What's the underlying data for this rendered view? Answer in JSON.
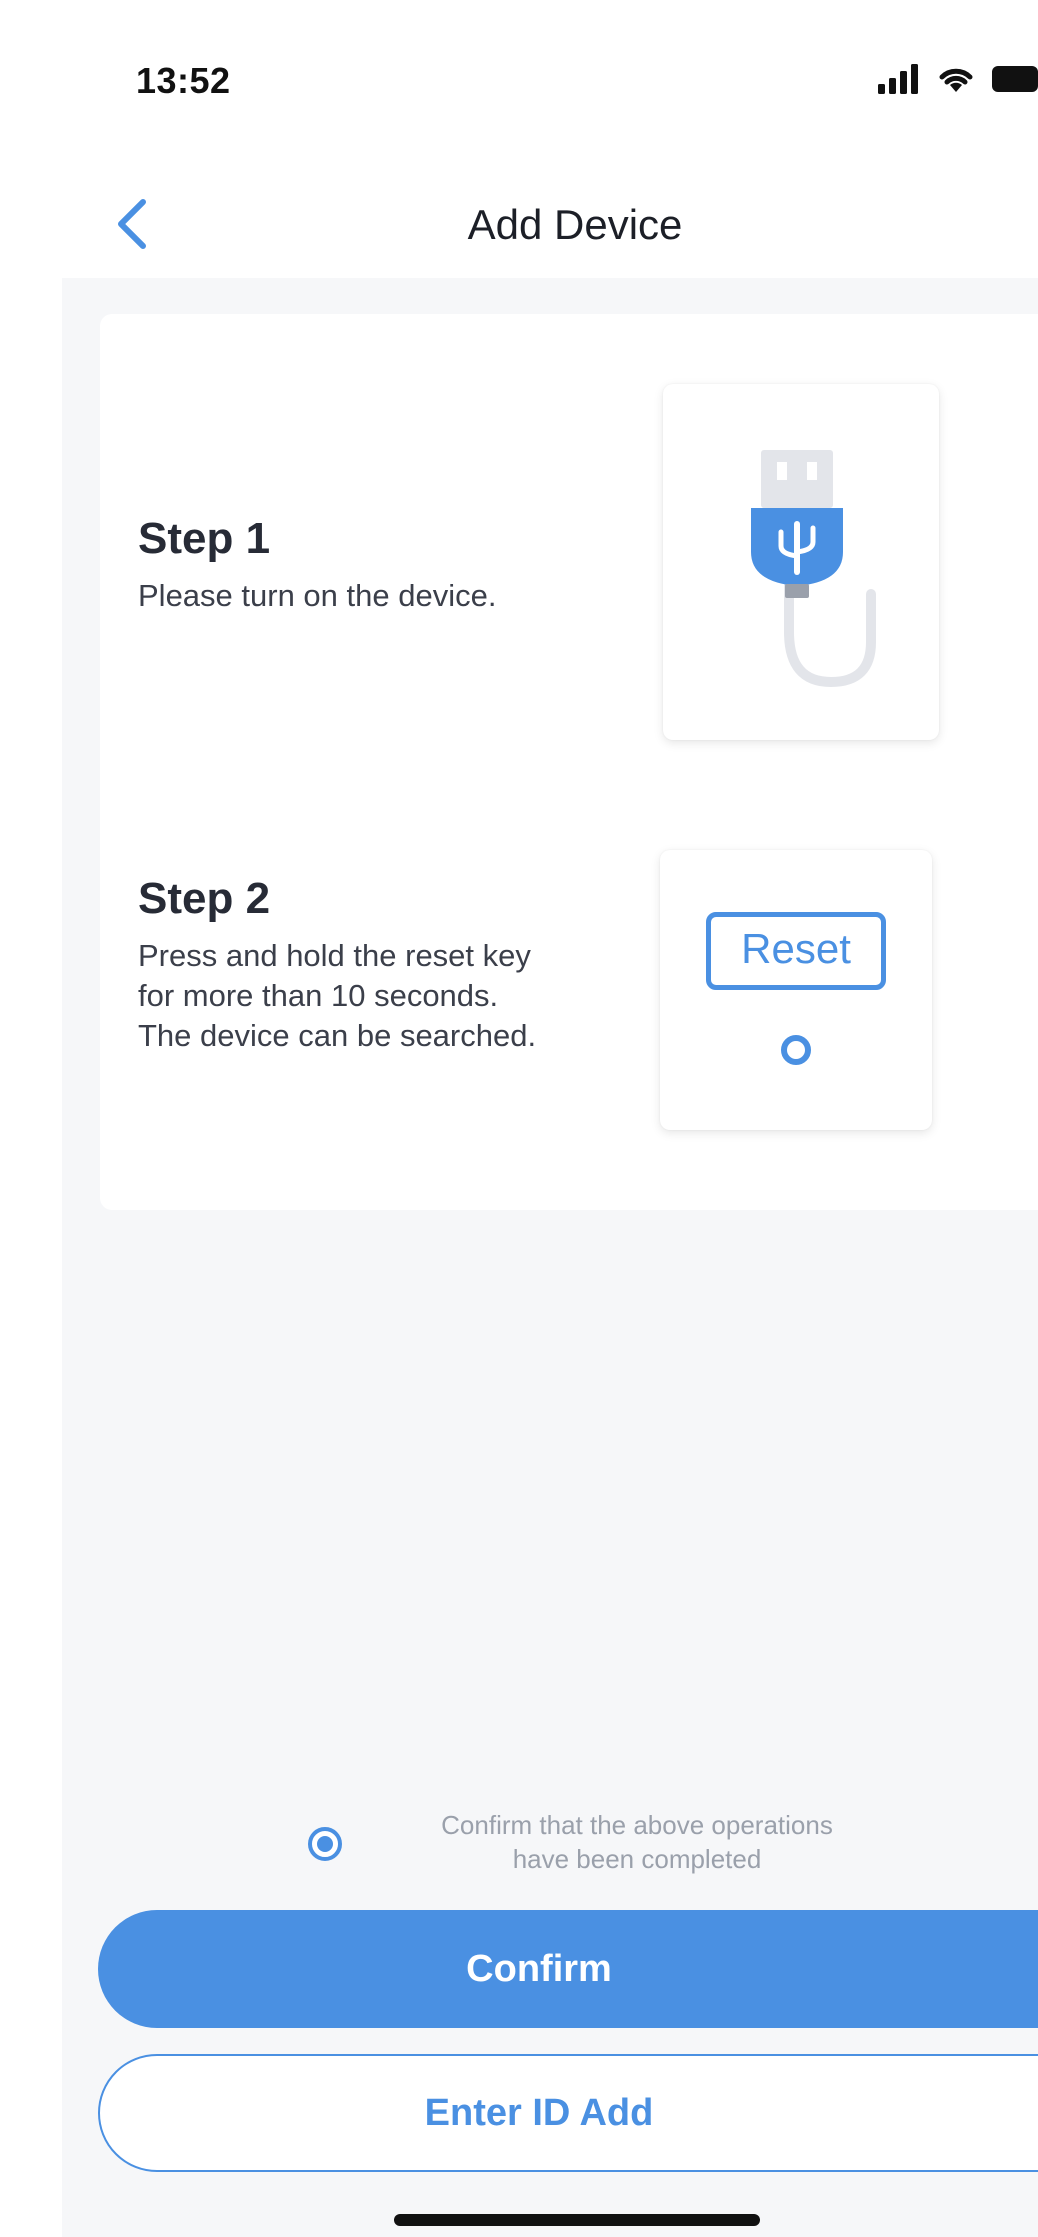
{
  "status_bar": {
    "time": "13:52",
    "icons": [
      "signal-icon",
      "wifi-icon",
      "battery-icon"
    ]
  },
  "nav": {
    "back_icon": "chevron-left-icon",
    "title": "Add Device"
  },
  "steps": [
    {
      "title": "Step 1",
      "description": "Please turn on the device.",
      "illustration_icon": "usb-plug-icon"
    },
    {
      "title": "Step 2",
      "description": "Press and hold the reset key for more than 10 seconds. The device can be searched.",
      "illustration_icon": "reset-button-icon",
      "illustration_label": "Reset"
    }
  ],
  "confirm": {
    "checked": true,
    "text_line1": "Confirm that the above operations",
    "text_line2": "have been completed"
  },
  "buttons": {
    "confirm_label": "Confirm",
    "enter_id_label": "Enter ID Add"
  },
  "colors": {
    "accent": "#4a90e2",
    "background": "#f6f7f9",
    "card": "#ffffff",
    "muted_text": "#9aa0ab"
  }
}
